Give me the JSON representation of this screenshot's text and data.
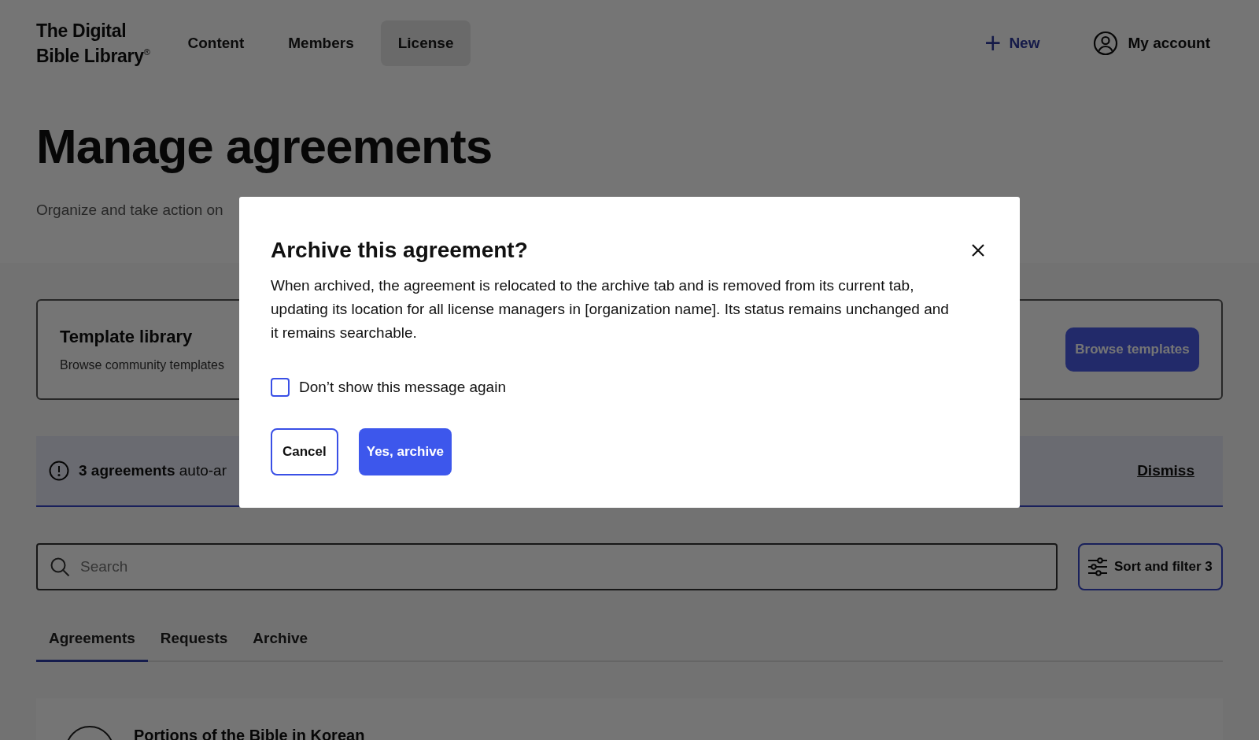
{
  "header": {
    "logo": {
      "line_1": "The Digital",
      "line_2": "Bible Library",
      "mark": "®"
    },
    "nav": [
      {
        "label": "Content",
        "selected": false
      },
      {
        "label": "Members",
        "selected": false
      },
      {
        "label": "License",
        "selected": true
      }
    ],
    "new_button": {
      "icon": "+",
      "label": "New"
    },
    "account": {
      "label": "My account"
    }
  },
  "page": {
    "title": "Manage agreements",
    "subtitle": "Organize and take action on"
  },
  "template_card": {
    "title": "Template library",
    "description": "Browse community templates",
    "button": "Browse templates"
  },
  "banner": {
    "text": "**3 agreements** auto-ar",
    "dismiss": "Dismiss"
  },
  "search": {
    "placeholder": "Search"
  },
  "sort_filter": {
    "label": "Sort and filter 3"
  },
  "tabs": [
    {
      "label": "Agreements",
      "selected": true
    },
    {
      "label": "Requests",
      "selected": false
    },
    {
      "label": "Archive",
      "selected": false
    }
  ],
  "agreements": [
    {
      "title": "Portions of the Bible in Korean"
    }
  ],
  "modal": {
    "title": "Archive this agreement?",
    "body": "When archived, the agreement is relocated to the archive tab and is removed from its current tab, updating its location for all license managers in [organization name]. Its status remains unchanged and it remains searchable.",
    "checkbox": {
      "label": "Don’t show this message again",
      "checked": false
    },
    "cancel": "Cancel",
    "confirm": "Yes, archive"
  }
}
